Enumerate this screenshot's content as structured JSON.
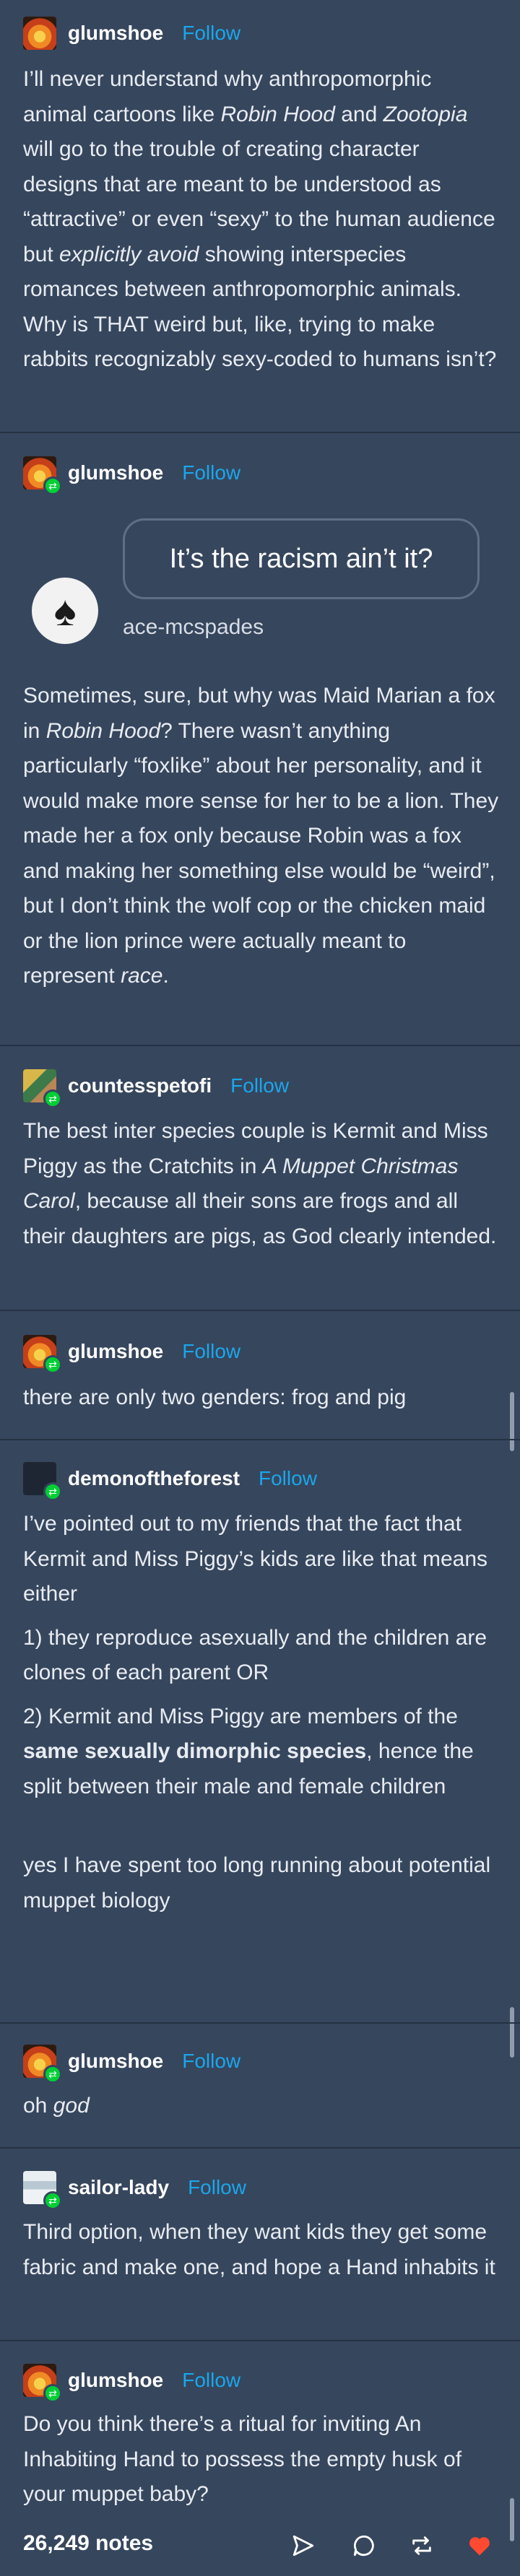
{
  "posts": [
    {
      "username": "glumshoe",
      "follow": "Follow",
      "avatar_icon": "flame-avatar",
      "body_html": "I’ll never understand why anthropomorphic animal cartoons like <i>Robin Hood</i> and <i>Zootopia</i> will go to the trouble of creating character designs that are meant to be understood as “attractive” or even “sexy” to the human audience but <i>explicitly avoid</i> showing interspecies romances between anthropomorphic animals. Why is THAT weird but, like, trying to make rabbits recognizably sexy-coded to humans isn’t?"
    },
    {
      "username": "glumshoe",
      "follow": "Follow",
      "avatar_icon": "flame-avatar",
      "ask": {
        "question": "It’s the racism ain’t it?",
        "asker": "ace-mcspades"
      },
      "body_html": "Sometimes, sure, but why was Maid Marian a fox in <i>Robin Hood</i>? There wasn’t anything particularly “foxlike” about her personality, and it would make more sense for her to be a lion. They made her a fox only because Robin was a fox and making her something else would be “weird”, but I don’t think the wolf cop or the chicken maid or the lion prince were actually meant to represent <i>race</i>."
    },
    {
      "username": "countesspetofi",
      "follow": "Follow",
      "avatar_icon": "portrait-avatar",
      "body_html": "The best inter species couple is Kermit and Miss Piggy as the Cratchits in <i>A Muppet Christmas Carol</i>, because all their sons are frogs and all their daughters are pigs, as God clearly intended."
    },
    {
      "username": "glumshoe",
      "follow": "Follow",
      "avatar_icon": "flame-avatar",
      "body_html": "there are only two genders: frog and pig"
    },
    {
      "username": "demonoftheforest",
      "follow": "Follow",
      "avatar_icon": "dark-avatar",
      "body_html": "<p>I’ve pointed out to my friends that the fact that Kermit and Miss Piggy’s kids are like that means either</p><p style=\"margin-top:12px\">1) they reproduce asexually and the children are clones of each parent OR</p><p style=\"margin-top:12px\">2) Kermit and Miss Piggy are members of the <b>same sexually dimorphic species</b>, hence the split between their male and female children</p><p style=\"margin-top:61px\">yes I have spent too long running about potential muppet biology</p>"
    },
    {
      "username": "glumshoe",
      "follow": "Follow",
      "avatar_icon": "flame-avatar",
      "body_html": "oh <i>god</i>"
    },
    {
      "username": "sailor-lady",
      "follow": "Follow",
      "avatar_icon": "screenshot-avatar",
      "body_html": "Third option, when they want kids they get some fabric and make one, and hope a Hand inhabits it"
    },
    {
      "username": "glumshoe",
      "follow": "Follow",
      "avatar_icon": "flame-avatar",
      "body_html": "Do you think there’s a ritual for inviting An Inhabiting Hand to possess the empty husk of your muppet baby?"
    }
  ],
  "footer": {
    "notes": "26,249 notes",
    "icons": [
      "share-icon",
      "reply-icon",
      "reblog-icon",
      "like-icon"
    ],
    "like_color": "#ff4930"
  },
  "colors": {
    "background": "#36465d",
    "link": "#1aa7ec",
    "reblog_badge": "#00cf35"
  }
}
